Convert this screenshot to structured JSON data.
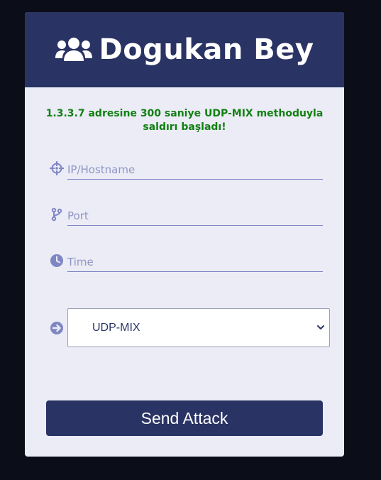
{
  "header": {
    "title": "Dogukan Bey",
    "icon": "users-icon"
  },
  "status_message": "1.3.3.7 adresine 300 saniye UDP-MIX methoduyla saldırı başladı!",
  "form": {
    "host": {
      "placeholder": "IP/Hostname",
      "value": "",
      "icon": "crosshair-icon"
    },
    "port": {
      "placeholder": "Port",
      "value": "",
      "icon": "branch-icon"
    },
    "time": {
      "placeholder": "Time",
      "value": "",
      "icon": "clock-icon"
    },
    "method": {
      "selected": "UDP-MIX",
      "icon": "arrow-circle-right-icon"
    }
  },
  "send_button": {
    "label": "Send Attack"
  },
  "colors": {
    "background": "#0b0d18",
    "card": "#ebecf6",
    "header": "#293364",
    "status_green": "#128012",
    "icon_accent": "#7f86c4"
  }
}
